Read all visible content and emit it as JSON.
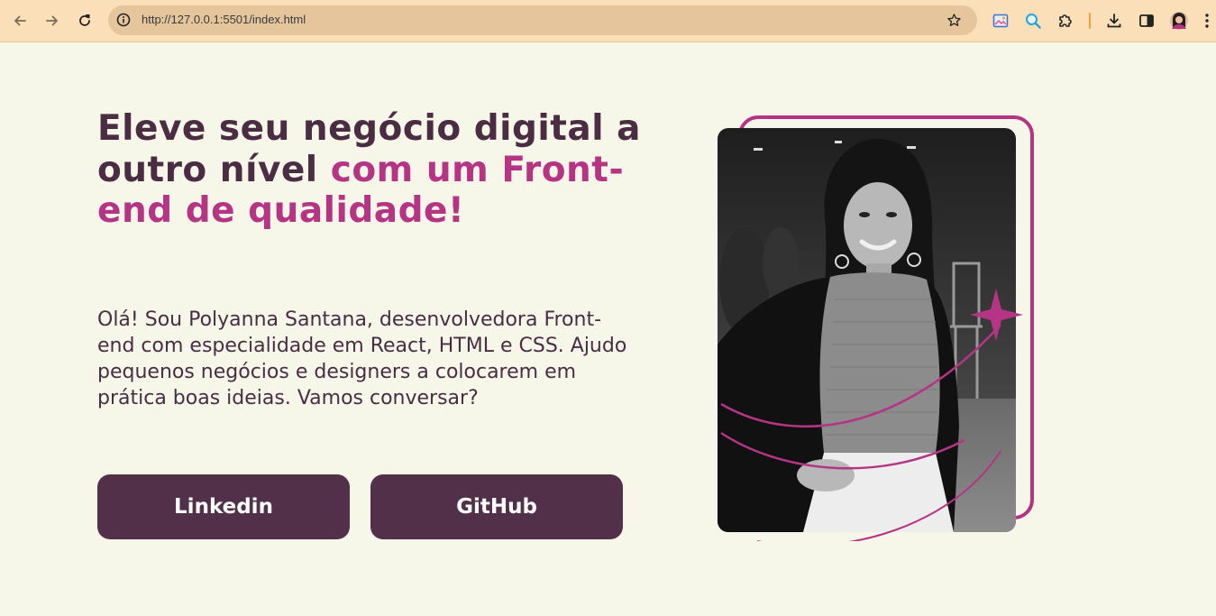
{
  "browser": {
    "url": "http://127.0.0.1:5501/index.html",
    "icons": [
      "back-icon",
      "forward-icon",
      "reload-icon",
      "site-info-icon",
      "star-icon",
      "extension-image-icon",
      "extension-search-icon",
      "extensions-puzzle-icon",
      "download-icon",
      "side-panel-icon",
      "profile-avatar",
      "menu-dots-icon"
    ]
  },
  "hero": {
    "headline_part1": "Eleve seu negócio digital a outro nível ",
    "headline_part2": "com um Front-end de qualidade!",
    "intro": "Olá! Sou Polyanna Santana, desenvolvedora Front-end com especialidade em React, HTML e CSS. Ajudo pequenos negócios e designers a colocarem em prática boas ideias. Vamos conversar?",
    "buttons": {
      "linkedin": "Linkedin",
      "github": "GitHub"
    }
  },
  "colors": {
    "background": "#F6F6E9",
    "headline": "#4A2D43",
    "accent": "#B53584",
    "button": "#52304A",
    "chrome": "#FBDFB9"
  }
}
